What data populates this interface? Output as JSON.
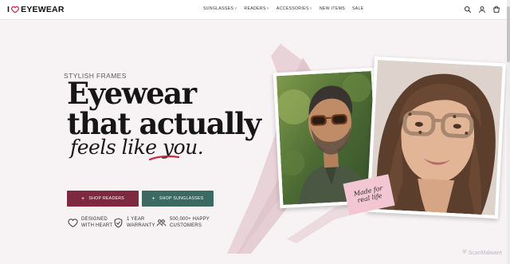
{
  "brand": {
    "pre": "I",
    "post": "EYEWEAR"
  },
  "nav": [
    {
      "label": "SUNGLASSES",
      "dropdown": true
    },
    {
      "label": "READERS",
      "dropdown": true
    },
    {
      "label": "ACCESSORIES",
      "dropdown": true
    },
    {
      "label": "NEW ITEMS",
      "dropdown": false
    },
    {
      "label": "SALE",
      "dropdown": false
    }
  ],
  "header_icons": [
    "search-icon",
    "account-icon",
    "cart-icon"
  ],
  "hero": {
    "eyebrow": "STYLISH FRAMES",
    "headline_line1": "Eyewear",
    "headline_line2": "that actually",
    "script_text": "feels like ",
    "script_emphasis": "you.",
    "buttons": {
      "readers": "SHOP READERS",
      "sunglasses": "SHOP SUNGLASSES"
    },
    "features": [
      {
        "icon": "heart-icon",
        "text": "DESIGNED\nWITH HEART"
      },
      {
        "icon": "shield-check-icon",
        "text": "1 YEAR\nWARRANTY"
      },
      {
        "icon": "people-icon",
        "text": "500,000+ HAPPY\nCUSTOMERS"
      }
    ],
    "tag": "Made for\nreal life"
  },
  "watermark": "ScanMalware",
  "colors": {
    "accent_wine": "#7d2a40",
    "accent_teal": "#3b6a62",
    "brush": "#e7d2d8",
    "heart": "#c8284a"
  }
}
